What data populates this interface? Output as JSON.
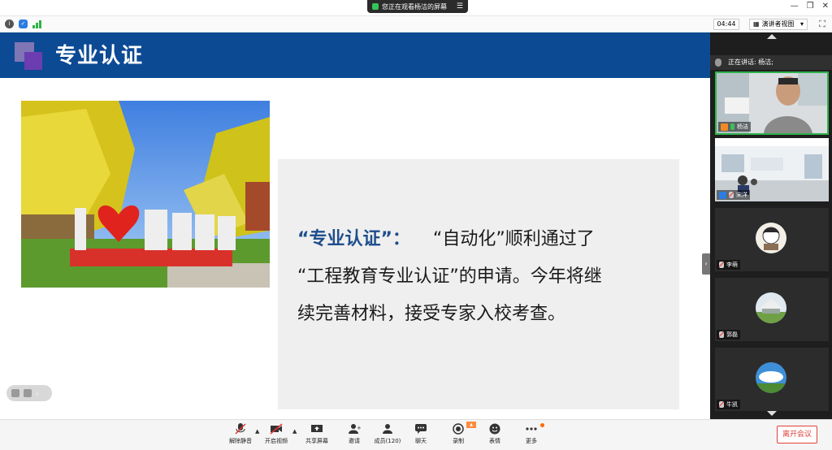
{
  "titlebar": {
    "share_notice": "您正在观看杨洁的屏幕",
    "window_controls": [
      "minimize",
      "restore",
      "close"
    ]
  },
  "toolbar": {
    "timer": "04:44",
    "view_mode": "演讲者视图"
  },
  "slide": {
    "title": "专业认证",
    "quote_highlight": "“专业认证”：",
    "quote_body_1": "“自动化”顺利通过了",
    "quote_body_2": "“工程教育专业认证”的申请。今年将继",
    "quote_body_3": "续完善材料，接受专家入校考查。",
    "photo_logo_text": "I ❤ BUPT"
  },
  "panel": {
    "speaking_label": "正在讲话: 杨洁;",
    "participants": [
      {
        "name": "杨洁",
        "video": true,
        "mic": "on",
        "host": true
      },
      {
        "name": "宋洋",
        "video": true,
        "mic": "off",
        "host": false
      },
      {
        "name": "李萌",
        "video": false,
        "mic": "off",
        "host": false
      },
      {
        "name": "郭磊",
        "video": false,
        "mic": "off",
        "host": false
      },
      {
        "name": "牛凯",
        "video": false,
        "mic": "off",
        "host": false
      }
    ]
  },
  "bottombar": {
    "unmute": "解除静音",
    "start_video": "开启视频",
    "share_screen": "共享屏幕",
    "invite": "邀请",
    "members": "成员(120)",
    "chat": "聊天",
    "record": "录制",
    "reactions": "表情",
    "more": "更多",
    "leave": "离开会议"
  },
  "colors": {
    "header_blue": "#0d4a94",
    "highlight_blue": "#1f4e8c",
    "leave_red": "#e0413a",
    "active_green": "#2fb34a"
  }
}
